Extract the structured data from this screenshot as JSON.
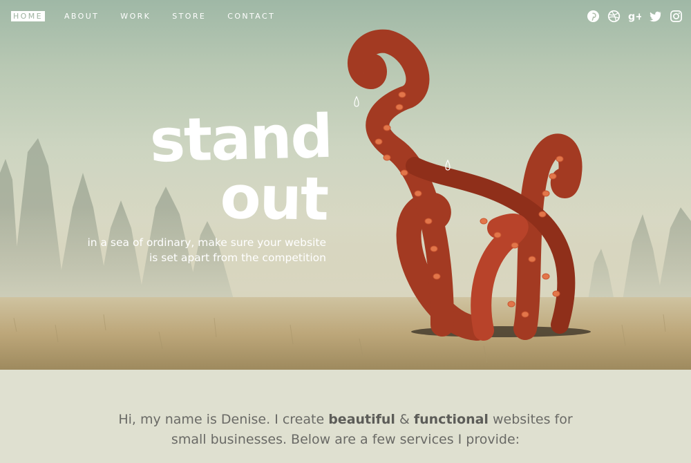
{
  "nav": {
    "items": [
      {
        "label": "HOME",
        "active": true
      },
      {
        "label": "ABOUT",
        "active": false
      },
      {
        "label": "WORK",
        "active": false
      },
      {
        "label": "STORE",
        "active": false
      },
      {
        "label": "CONTACT",
        "active": false
      }
    ]
  },
  "social": [
    "pinterest-icon",
    "dribbble-icon",
    "google-plus-icon",
    "twitter-icon",
    "instagram-icon"
  ],
  "hero": {
    "headline_line1": "stand",
    "headline_line2": "out",
    "tagline_line1": "in a sea of ordinary, make sure your website",
    "tagline_line2": "is set apart from the competition"
  },
  "intro": {
    "part1": "Hi, my name is Denise. I create ",
    "bold1": "beautiful",
    "part2": " & ",
    "bold2": "functional",
    "part3": " websites for",
    "line2": "small businesses. Below are a few services I provide:"
  },
  "colors": {
    "tentacle": "#a33a22",
    "sucker": "#e2764a",
    "nav_active_text": "#9db29f",
    "intro_bg": "#dfe0d0"
  }
}
